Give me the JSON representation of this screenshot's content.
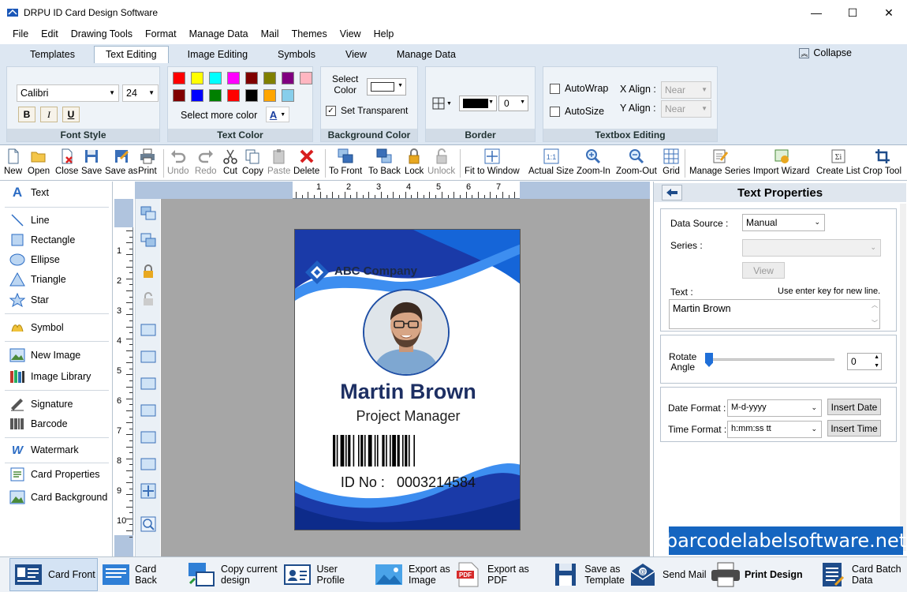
{
  "window": {
    "title": "DRPU ID Card Design Software",
    "minimize": "—",
    "maximize": "☐",
    "close": "✕"
  },
  "menu": [
    "File",
    "Edit",
    "Drawing Tools",
    "Format",
    "Manage Data",
    "Mail",
    "Themes",
    "View",
    "Help"
  ],
  "ribbon_tabs": [
    "Templates",
    "Text Editing",
    "Image Editing",
    "Symbols",
    "View",
    "Manage Data"
  ],
  "active_tab": "Text Editing",
  "collapse_label": "Collapse",
  "font_style": {
    "group": "Font Style",
    "font": "Calibri",
    "size": "24",
    "bold": "B",
    "italic": "I",
    "underline": "U"
  },
  "text_color": {
    "group": "Text Color",
    "more": "Select more color",
    "font_color_glyph": "A",
    "swatches": [
      "#ff0000",
      "#ffff00",
      "#00ffff",
      "#ff00ff",
      "#800000",
      "#808000",
      "#800080",
      "#ffb6c1",
      "#800000",
      "#0000ff",
      "#008000",
      "#ff0000",
      "#000000",
      "#ffa500",
      "#87ceeb"
    ]
  },
  "background_color": {
    "group": "Background Color",
    "select_line1": "Select",
    "select_line2": "Color",
    "set_transparent": "Set Transparent"
  },
  "border": {
    "group": "Border",
    "width": "0"
  },
  "textbox_editing": {
    "group": "Textbox Editing",
    "autowrap": "AutoWrap",
    "autosize": "AutoSize",
    "xalign_label": "X Align :",
    "yalign_label": "Y Align :",
    "xalign": "Near",
    "yalign": "Near"
  },
  "toolbar": {
    "new": "New",
    "open": "Open",
    "close": "Close",
    "save": "Save",
    "save_as": "Save as",
    "print": "Print",
    "undo": "Undo",
    "redo": "Redo",
    "cut": "Cut",
    "copy": "Copy",
    "paste": "Paste",
    "delete": "Delete",
    "to_front": "To Front",
    "to_back": "To Back",
    "lock": "Lock",
    "unlock": "Unlock",
    "fit": "Fit to Window",
    "actual": "Actual Size",
    "zoom_in": "Zoom-In",
    "zoom_out": "Zoom-Out",
    "grid": "Grid",
    "manage_series": "Manage Series",
    "import_wizard": "Import Wizard",
    "create_list": "Create List",
    "crop_tool": "Crop Tool"
  },
  "tools": {
    "text": "Text",
    "line": "Line",
    "rectangle": "Rectangle",
    "ellipse": "Ellipse",
    "triangle": "Triangle",
    "star": "Star",
    "symbol": "Symbol",
    "new_image": "New Image",
    "image_library": "Image Library",
    "signature": "Signature",
    "barcode": "Barcode",
    "watermark": "Watermark",
    "card_properties": "Card Properties",
    "card_background": "Card Background"
  },
  "ruler": {
    "top": [
      "1",
      "2",
      "3",
      "4",
      "5",
      "6",
      "7"
    ],
    "left": [
      "1",
      "2",
      "3",
      "4",
      "5",
      "6",
      "7",
      "8",
      "9",
      "10"
    ]
  },
  "card": {
    "company": "ABC Company",
    "name": "Martin Brown",
    "role": "Project Manager",
    "id_label": "ID No :",
    "id_value": "0003214584"
  },
  "properties": {
    "title": "Text Properties",
    "data_source_label": "Data Source :",
    "data_source": "Manual",
    "series_label": "Series :",
    "view_btn": "View",
    "text_label": "Text :",
    "hint": "Use enter key for new line.",
    "text_value": "Martin Brown",
    "rotate_line1": "Rotate",
    "rotate_line2": "Angle",
    "rotate_value": "0",
    "date_format_label": "Date Format :",
    "date_format": "M-d-yyyy",
    "insert_date": "Insert Date",
    "time_format_label": "Time Format :",
    "time_format": "h:mm:ss tt",
    "insert_time": "Insert Time"
  },
  "watermark": "barcodelabelsoftware.net",
  "bottom": {
    "card_front": "Card Front",
    "card_back": "Card Back",
    "copy1": "Copy current",
    "copy2": "design",
    "user_profile": "User Profile",
    "export_image1": "Export as",
    "export_image2": "Image",
    "export_pdf": "Export as PDF",
    "save_template1": "Save as",
    "save_template2": "Template",
    "send_mail": "Send Mail",
    "print_design": "Print Design",
    "batch1": "Card Batch",
    "batch2": "Data"
  }
}
